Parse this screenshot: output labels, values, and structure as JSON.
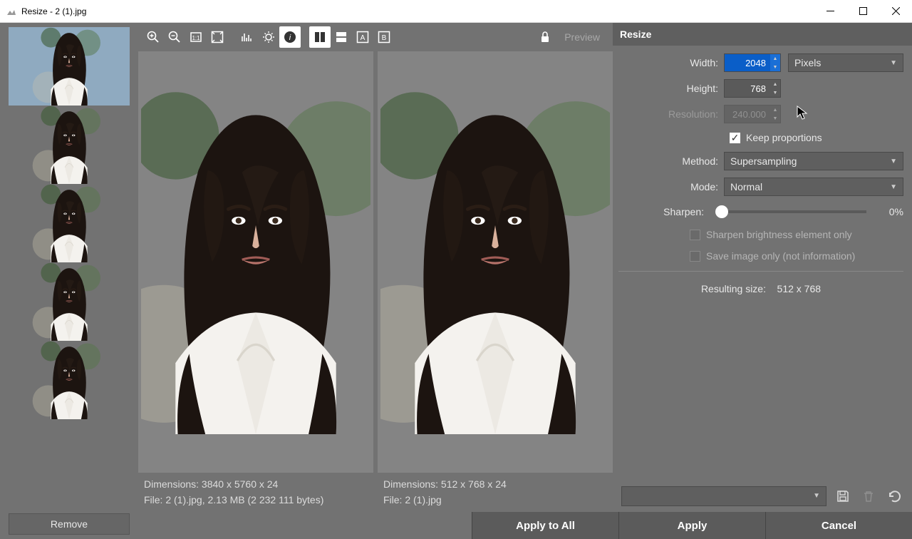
{
  "window": {
    "title": "Resize - 2 (1).jpg"
  },
  "thumbnails": {
    "count": 5,
    "selected_index": 0
  },
  "toolbar": {
    "preview_label": "Preview",
    "compare_a": "A",
    "compare_b": "B"
  },
  "preview": {
    "left": {
      "dimensions_line": "Dimensions: 3840 x 5760 x 24",
      "file_line": "File: 2 (1).jpg, 2.13 MB (2 232 111 bytes)"
    },
    "right": {
      "dimensions_line": "Dimensions: 512 x 768 x 24",
      "file_line": "File: 2 (1).jpg"
    }
  },
  "panel": {
    "title": "Resize",
    "width_label": "Width:",
    "width_value": "2048",
    "height_label": "Height:",
    "height_value": "768",
    "resolution_label": "Resolution:",
    "resolution_value": "240.000",
    "unit_value": "Pixels",
    "keep_proportions": "Keep proportions",
    "method_label": "Method:",
    "method_value": "Supersampling",
    "mode_label": "Mode:",
    "mode_value": "Normal",
    "sharpen_label": "Sharpen:",
    "sharpen_value": "0%",
    "sharpen_brightness": "Sharpen brightness element only",
    "save_image_only": "Save image only (not information)",
    "resulting_label": "Resulting size:",
    "resulting_value": "512 x 768"
  },
  "footer": {
    "remove": "Remove",
    "apply_all": "Apply to All",
    "apply": "Apply",
    "cancel": "Cancel"
  }
}
